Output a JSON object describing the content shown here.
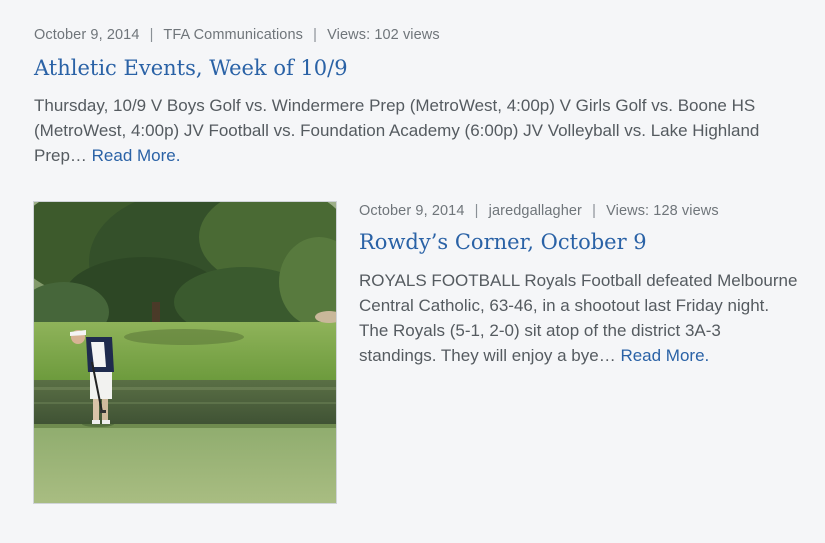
{
  "posts": [
    {
      "date": "October 9, 2014",
      "author": "TFA Communications",
      "views": "Views: 102 views",
      "title": "Athletic Events, Week of 10/9",
      "excerpt": "Thursday, 10/9 V Boys Golf vs. Windermere Prep (MetroWest, 4:00p) V Girls Golf vs. Boone HS (MetroWest, 4:00p) JV Football vs. Foundation Academy (6:00p) JV Volleyball vs. Lake Highland Prep… ",
      "read_more": "Read More."
    },
    {
      "date": "October 9, 2014",
      "author": "jaredgallagher",
      "views": "Views: 128 views",
      "title": "Rowdy’s Corner, October 9",
      "excerpt": "ROYALS FOOTBALL Royals Football defeated Melbourne Central Catholic, 63-46, in a shootout last Friday night. The Royals (5-1, 2-0) sit atop of the district 3A-3 standings. They will enjoy a bye… ",
      "read_more": "Read More.",
      "thumbnail": "golfer-putting-photo"
    }
  ],
  "separator": "|"
}
